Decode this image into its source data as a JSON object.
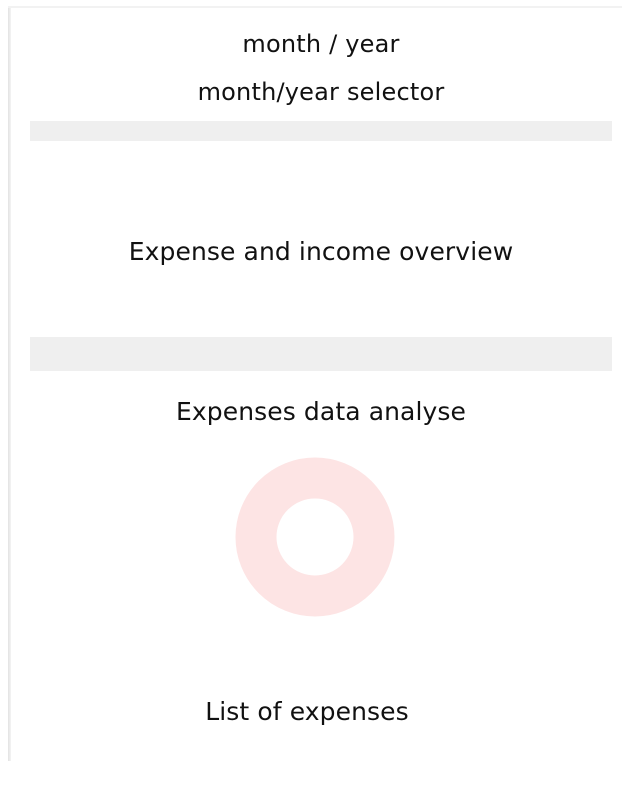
{
  "header": {
    "period_label": "month / year",
    "selector_label": "month/year selector"
  },
  "overview": {
    "label": "Expense and income overview"
  },
  "analysis": {
    "title": "Expenses data analyse",
    "chart_color": "#fde4e4"
  },
  "expenses": {
    "label": "List of expenses"
  }
}
